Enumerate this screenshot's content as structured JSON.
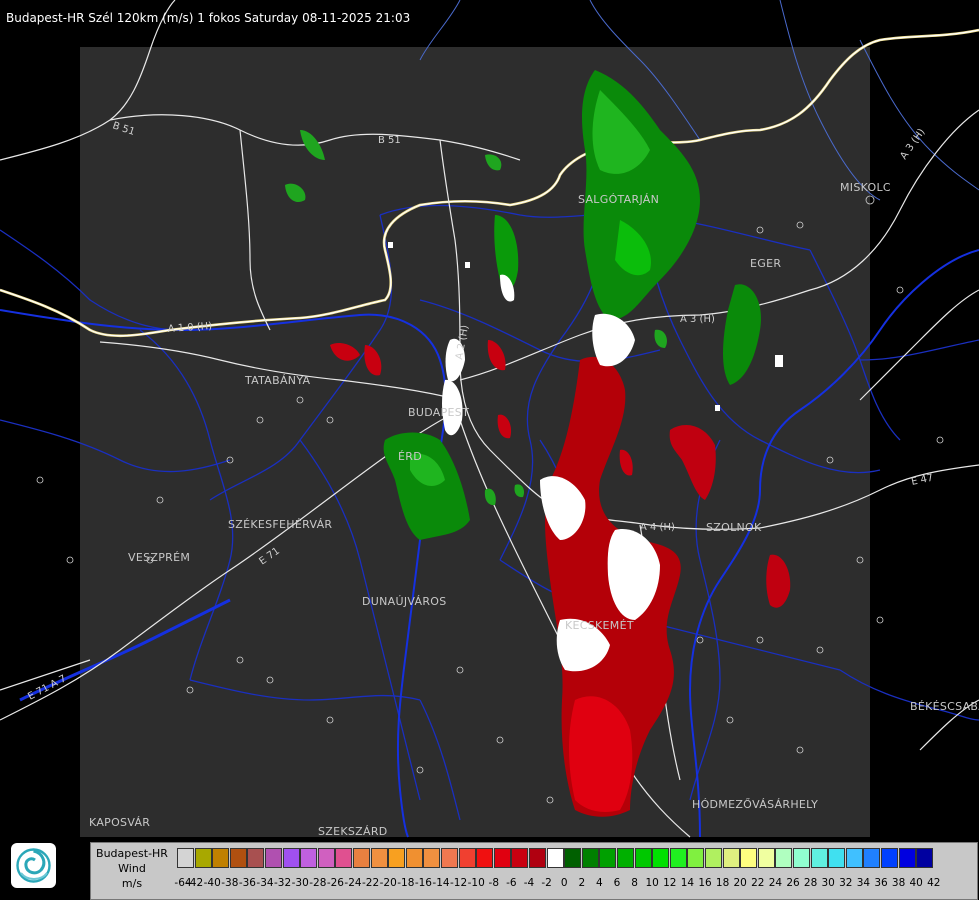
{
  "header": {
    "title": "Budapest-HR Szél 120km (m/s) 1 fokos Saturday 08-11-2025 21:03"
  },
  "cities": [
    {
      "name": "SALGÓTARJÁN",
      "key": "salgotarjan"
    },
    {
      "name": "MISKOLC",
      "key": "miskolc"
    },
    {
      "name": "EGER",
      "key": "eger"
    },
    {
      "name": "TATABÁNYA",
      "key": "tatabanya"
    },
    {
      "name": "BUDAPEST",
      "key": "budapest"
    },
    {
      "name": "ÉRD",
      "key": "erd"
    },
    {
      "name": "SZÉKESFEHÉRVÁR",
      "key": "szekesfehervar"
    },
    {
      "name": "VESZPRÉM",
      "key": "veszprem"
    },
    {
      "name": "DUNAÚJVÁROS",
      "key": "dunaujvaros"
    },
    {
      "name": "SZOLNOK",
      "key": "szolnok"
    },
    {
      "name": "KECSKEMÉT",
      "key": "kecskemet"
    },
    {
      "name": "BÉKÉSCSABA",
      "key": "bekescsaba"
    },
    {
      "name": "HÓDMEZŐVÁSÁRHELY",
      "key": "hodmezovasarhely"
    },
    {
      "name": "KAPOSVÁR",
      "key": "kaposvar"
    },
    {
      "name": "SZEKSZÁRD",
      "key": "szekszard"
    }
  ],
  "roads": [
    "B 51",
    "B 51",
    "A 1 0 (H)",
    "A 3 (H)",
    "A 3 (H)",
    "A 4 (H)",
    "E 71",
    "E 71 A 7",
    "A 2 (H)",
    "E 47"
  ],
  "legend": {
    "title_line1": "Budapest-HR",
    "title_line2": "Wind",
    "title_line3": "m/s",
    "ticks": [
      "-64",
      "-42",
      "-40",
      "-38",
      "-36",
      "-34",
      "-32",
      "-30",
      "-28",
      "-26",
      "-24",
      "-22",
      "-20",
      "-18",
      "-16",
      "-14",
      "-12",
      "-10",
      "-8",
      "-6",
      "-4",
      "-2",
      "0",
      "2",
      "4",
      "6",
      "8",
      "10",
      "12",
      "14",
      "16",
      "18",
      "20",
      "22",
      "24",
      "26",
      "28",
      "30",
      "32",
      "34",
      "36",
      "38",
      "40",
      "42"
    ],
    "colors": [
      "#d4d4d4",
      "#a8a800",
      "#c08000",
      "#b05010",
      "#a85050",
      "#b050b0",
      "#a050f0",
      "#c060e0",
      "#d060c0",
      "#e05090",
      "#e88040",
      "#f09040",
      "#f8a020",
      "#f09030",
      "#f09040",
      "#f07850",
      "#f04030",
      "#f01010",
      "#e00010",
      "#c80010",
      "#b00010",
      "#ffffff",
      "#006000",
      "#008000",
      "#00a000",
      "#00b000",
      "#00c800",
      "#00e000",
      "#20f020",
      "#80f040",
      "#b0f060",
      "#e0f080",
      "#ffff80",
      "#f0ffa0",
      "#b0ffc0",
      "#90ffd0",
      "#60f0e0",
      "#40e0f0",
      "#40c0ff",
      "#2080ff",
      "#0040ff",
      "#0000e0",
      "#0000a0"
    ],
    "logo": "omsz-swirl-logo"
  }
}
